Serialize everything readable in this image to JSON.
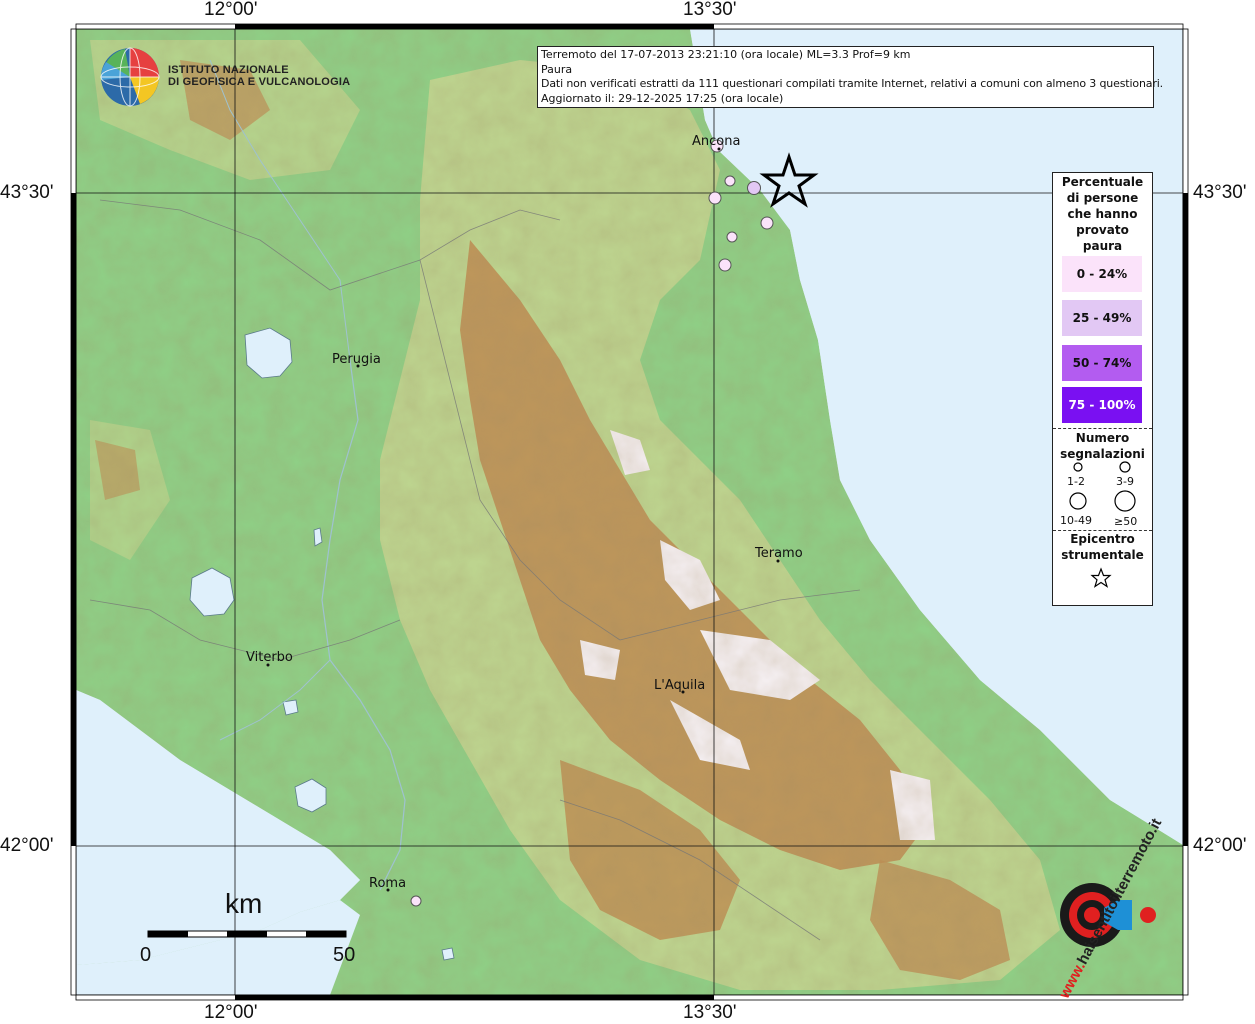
{
  "map": {
    "top_ticks": [
      "12°00'",
      "13°30'"
    ],
    "bottom_ticks": [
      "12°00'",
      "13°30'"
    ],
    "left_ticks": [
      "43°30'",
      "42°00'"
    ],
    "right_ticks": [
      "43°30'",
      "42°00'"
    ],
    "colors": {
      "sea": "#dff0fb",
      "lowland": "#8fcf86",
      "hills": "#c9d48e",
      "mountains": "#b98a4e",
      "peaks": "#f4eef0",
      "frame": "#000000"
    }
  },
  "logo": {
    "line1": "ISTITUTO NAZIONALE",
    "line2": "DI GEOFISICA E VULCANOLOGIA",
    "icon": "ingv-globe-icon"
  },
  "info": {
    "line1": "Terremoto del 17-07-2013 23:21:10 (ora locale) ML=3.3 Prof=9 km",
    "line2": "Paura",
    "line3": "Dati non verificati estratti da 111 questionari compilati tramite Internet, relativi a comuni con almeno 3 questionari.",
    "line4": "Aggiornato il: 29-12-2025 17:25 (ora locale)"
  },
  "cities": {
    "ancona": "Ancona",
    "perugia": "Perugia",
    "teramo": "Teramo",
    "viterbo": "Viterbo",
    "laquila": "L'Aquila",
    "roma": "Roma"
  },
  "legend": {
    "title_lines": [
      "Percentuale",
      "di persone",
      "che hanno",
      "provato",
      "paura"
    ],
    "classes": [
      {
        "label": "0 - 24%",
        "color": "#fbe3fa"
      },
      {
        "label": "25 - 49%",
        "color": "#e2c8f4"
      },
      {
        "label": "50 - 74%",
        "color": "#b35cf0"
      },
      {
        "label": "75 - 100%",
        "color": "#7a10f2"
      }
    ],
    "count_title_lines": [
      "Numero",
      "segnalazioni"
    ],
    "count_labels": [
      "1-2",
      "3-9",
      "10-49",
      "≥50"
    ],
    "epicenter_title_lines": [
      "Epicentro",
      "strumentale"
    ],
    "epicenter_icon": "star-icon"
  },
  "scale": {
    "unit": "km",
    "min": "0",
    "max": "50"
  },
  "site_logo": {
    "text": "haisentitoilterremoto.it",
    "url_text": "www.",
    "icon": "target-speaker-icon"
  }
}
